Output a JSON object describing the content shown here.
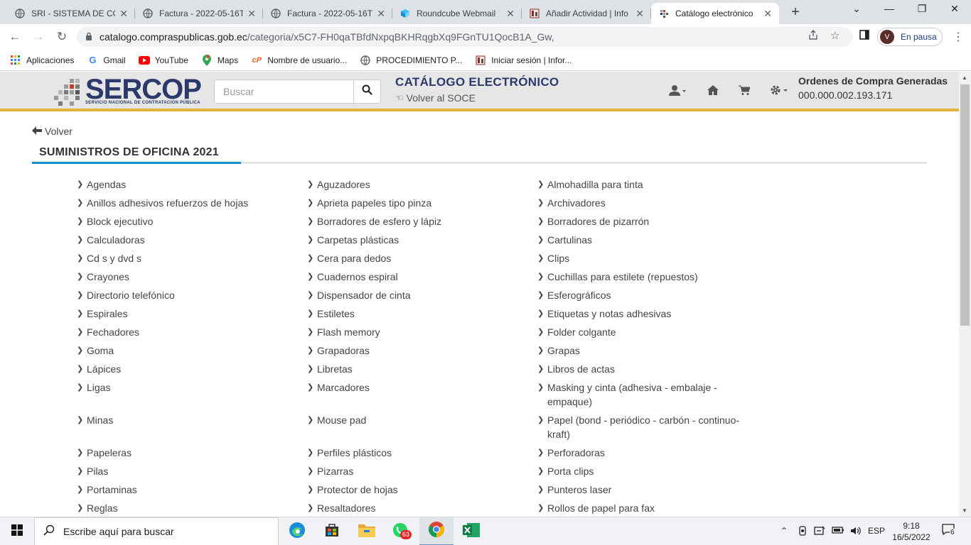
{
  "browser": {
    "tabs": [
      {
        "title": "SRI - SISTEMA DE CON",
        "icon": "globe-icon"
      },
      {
        "title": "Factura - 2022-05-16T",
        "icon": "globe-icon"
      },
      {
        "title": "Factura - 2022-05-16T",
        "icon": "globe-icon"
      },
      {
        "title": "Roundcube Webmail",
        "icon": "roundcube-icon"
      },
      {
        "title": "Añadir Actividad | Info",
        "icon": "site-icon"
      },
      {
        "title": "Catálogo electrónico",
        "icon": "sercop-icon"
      }
    ],
    "url_host": "catalogo.compraspublicas.gob.ec",
    "url_path": "/categoria/x5C7-FH0qaTBfdNxpqBKHRqgbXq9FGnTU1QocB1A_Gw,",
    "profile_initial": "V",
    "profile_status": "En pausa",
    "bookmarks": [
      {
        "label": "Aplicaciones",
        "icon": "apps-grid-icon"
      },
      {
        "label": "Gmail",
        "icon": "google-icon"
      },
      {
        "label": "YouTube",
        "icon": "youtube-icon"
      },
      {
        "label": "Maps",
        "icon": "maps-pin-icon"
      },
      {
        "label": "Nombre de usuario...",
        "icon": "cp-icon"
      },
      {
        "label": "PROCEDIMIENTO P...",
        "icon": "globe-icon"
      },
      {
        "label": "Iniciar sesión | Infor...",
        "icon": "site-icon"
      }
    ]
  },
  "header": {
    "logo_text": "SERCOP",
    "logo_subtitle": "SERVICIO NACIONAL DE CONTRATACIÓN PÚBLICA",
    "search_placeholder": "Buscar",
    "catalog_title": "CATÁLOGO ELECTRÓNICO",
    "back_to_soce": "Volver al SOCE",
    "orders_title": "Ordenes de Compra Generadas",
    "orders_value": "000.000.002.193.171"
  },
  "page": {
    "back_label": "Volver",
    "section_title": "SUMINISTROS DE OFICINA 2021",
    "columns": [
      [
        "Agendas",
        "Anillos adhesivos refuerzos de hojas",
        "Block ejecutivo",
        "Calculadoras",
        "Cd s y dvd s",
        "Crayones",
        "Directorio telefónico",
        "Espirales",
        "Fechadores",
        "Goma",
        "Lápices",
        "Ligas",
        "Minas",
        "Papeleras",
        "Pilas",
        "Portaminas",
        "Reglas"
      ],
      [
        "Aguzadores",
        "Aprieta papeles tipo pinza",
        "Borradores de esfero y lápiz",
        "Carpetas plásticas",
        "Cera para dedos",
        "Cuadernos espiral",
        "Dispensador de cinta",
        "Estiletes",
        "Flash memory",
        "Grapadoras",
        "Libretas",
        "Marcadores",
        "Mouse pad",
        "Perfiles plásticos",
        "Pizarras",
        "Protector de hojas",
        "Resaltadores"
      ],
      [
        "Almohadilla para tinta",
        "Archivadores",
        "Borradores de pizarrón",
        "Cartulinas",
        "Clips",
        "Cuchillas para estilete (repuestos)",
        "Esferográficos",
        "Etiquetas y notas adhesivas",
        "Folder colgante",
        "Grapas",
        "Libros de actas",
        "Masking y cinta (adhesiva - embalaje - empaque)",
        "Papel (bond - periódico - carbón - continuo- kraft)",
        "Perforadoras",
        "Porta clips",
        "Punteros laser",
        "Rollos de papel para fax"
      ]
    ]
  },
  "taskbar": {
    "search_placeholder": "Escribe aquí para buscar",
    "whatsapp_badge": "63",
    "language": "ESP",
    "time": "9:18",
    "date": "16/5/2022",
    "notification_count": "6"
  }
}
